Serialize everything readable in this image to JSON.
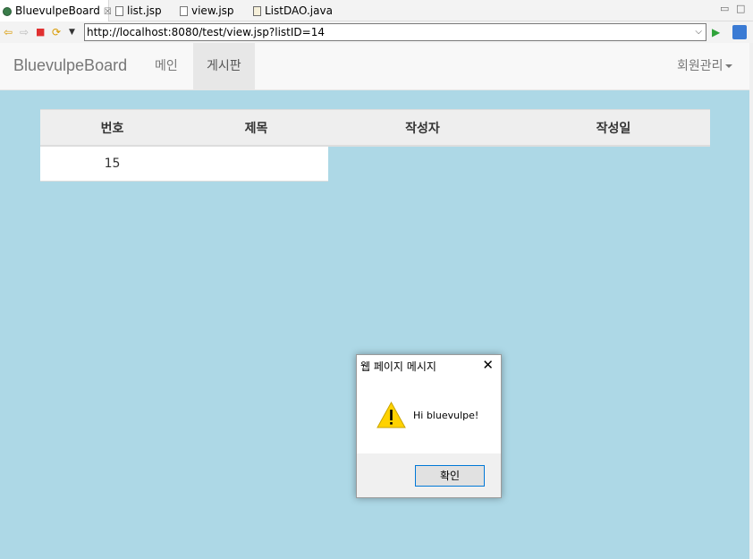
{
  "tabs": [
    {
      "label": "BluevulpeBoard",
      "icon": "globe-icon",
      "active": true,
      "close": "☒"
    },
    {
      "label": "list.jsp",
      "icon": "jsp-file-icon"
    },
    {
      "label": "view.jsp",
      "icon": "jsp-file-icon"
    },
    {
      "label": "ListDAO.java",
      "icon": "java-file-icon"
    }
  ],
  "toolbar": {
    "url": "http://localhost:8080/test/view.jsp?listID=14"
  },
  "navbar": {
    "brand": "BluevulpeBoard",
    "items": [
      "메인",
      "게시판"
    ],
    "active_item": "게시판",
    "member_menu": "회원관리"
  },
  "table": {
    "headers": [
      "번호",
      "제목",
      "작성자",
      "작성일"
    ],
    "rows": [
      [
        "15",
        "",
        "",
        ""
      ]
    ]
  },
  "dialog": {
    "title": "웹 페이지 메시지",
    "message": "Hi bluevulpe!",
    "ok_label": "확인"
  },
  "colors": {
    "page_background": "#add8e6",
    "navbar_background": "#f8f8f8",
    "warning_yellow": "#ffd200",
    "dialog_button_border": "#0078d7"
  }
}
